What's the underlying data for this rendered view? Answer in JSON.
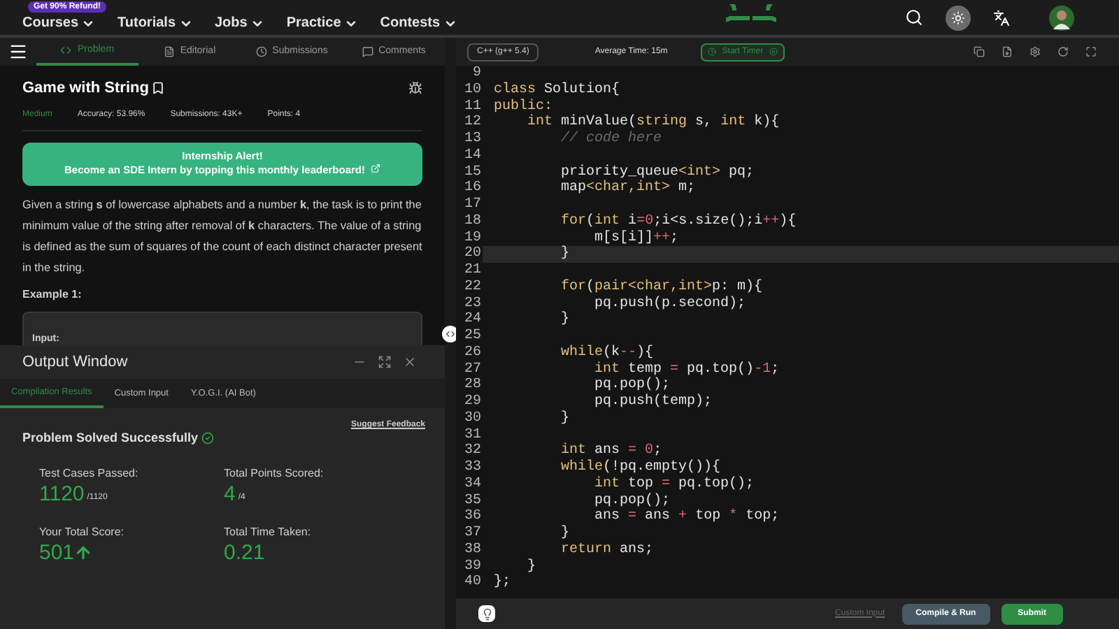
{
  "promo_badge": "Get 90% Refund!",
  "nav": [
    {
      "label": "Courses"
    },
    {
      "label": "Tutorials"
    },
    {
      "label": "Jobs"
    },
    {
      "label": "Practice"
    },
    {
      "label": "Contests"
    }
  ],
  "problem_tabs": [
    {
      "label": "Problem",
      "selected": true
    },
    {
      "label": "Editorial",
      "selected": false
    },
    {
      "label": "Submissions",
      "selected": false
    },
    {
      "label": "Comments",
      "selected": false
    }
  ],
  "problem": {
    "title": "Game with String",
    "difficulty": "Medium",
    "accuracy": "Accuracy: 53.96%",
    "submissions": "Submissions: 43K+",
    "points": "Points: 4",
    "alert": {
      "title": "Internship Alert!",
      "text": "Become an SDE Intern by topping this monthly leaderboard!"
    },
    "description": "Given a string **s** of lowercase alphabets and a number **k**, the task is to print the minimum value of the string after removal of **k** characters. The value of a string is defined as the sum of squares of the count of each distinct character present in the string.",
    "example_heading": "Example 1:",
    "example_input": "Input:"
  },
  "output_window": {
    "title": "Output Window",
    "tabs": [
      {
        "label": "Compilation Results",
        "selected": true
      },
      {
        "label": "Custom Input",
        "selected": false
      },
      {
        "label": "Y.O.G.I. (AI Bot)",
        "selected": false
      }
    ],
    "feedback_link": "Suggest Feedback",
    "status": "Problem Solved Successfully",
    "stats": [
      {
        "label": "Test Cases Passed:",
        "value": "1120",
        "total": "/1120",
        "rising": false
      },
      {
        "label": "Total Points Scored:",
        "value": "4",
        "total": "/4",
        "rising": false
      },
      {
        "label": "Your Total Score:",
        "value": "501",
        "rising": true
      },
      {
        "label": "Total Time Taken:",
        "value": "0.21",
        "rising": false
      }
    ]
  },
  "editor": {
    "language": "C++ (g++ 5.4)",
    "average_time": "Average Time: 15m",
    "timer_button": "Start Timer",
    "lines": [
      {
        "number": "9",
        "current": false
      },
      {
        "number": "10",
        "current": false,
        "tokens": [
          {
            "kind": "kw",
            "text": "class"
          },
          {
            "kind": "id",
            "text": " Solution{"
          }
        ]
      },
      {
        "number": "11",
        "current": false,
        "tokens": [
          {
            "kind": "kw",
            "text": "public:"
          }
        ]
      },
      {
        "number": "12",
        "current": false,
        "tokens": [
          {
            "kind": "kw",
            "text": "    int"
          },
          {
            "kind": "id",
            "text": " minValue("
          },
          {
            "kind": "kw",
            "text": "string"
          },
          {
            "kind": "id",
            "text": " s, "
          },
          {
            "kind": "kw",
            "text": "int"
          },
          {
            "kind": "id",
            "text": " k){"
          }
        ]
      },
      {
        "number": "13",
        "current": false,
        "tokens": [
          {
            "kind": "cm",
            "text": "        // code here"
          }
        ]
      },
      {
        "number": "14",
        "current": false
      },
      {
        "number": "15",
        "current": false,
        "tokens": [
          {
            "kind": "id",
            "text": "        priority_queue"
          },
          {
            "kind": "kw",
            "text": "<int>"
          },
          {
            "kind": "id",
            "text": " pq;"
          }
        ]
      },
      {
        "number": "16",
        "current": false,
        "tokens": [
          {
            "kind": "id",
            "text": "        map"
          },
          {
            "kind": "kw",
            "text": "<char,int>"
          },
          {
            "kind": "id",
            "text": " m;"
          }
        ]
      },
      {
        "number": "17",
        "current": false
      },
      {
        "number": "18",
        "current": false,
        "tokens": [
          {
            "kind": "kw",
            "text": "        for"
          },
          {
            "kind": "id",
            "text": "("
          },
          {
            "kind": "kw",
            "text": "int"
          },
          {
            "kind": "id",
            "text": " i"
          },
          {
            "kind": "op",
            "text": "="
          },
          {
            "kind": "num",
            "text": "0"
          },
          {
            "kind": "id",
            "text": ";i<s.size();i"
          },
          {
            "kind": "op",
            "text": "++"
          },
          {
            "kind": "id",
            "text": "){"
          }
        ]
      },
      {
        "number": "19",
        "current": false,
        "tokens": [
          {
            "kind": "id",
            "text": "            m[s[i]]"
          },
          {
            "kind": "op",
            "text": "++"
          },
          {
            "kind": "id",
            "text": ";"
          }
        ]
      },
      {
        "number": "20",
        "current": true,
        "tokens": [
          {
            "kind": "id",
            "text": "        }"
          }
        ]
      },
      {
        "number": "21",
        "current": false
      },
      {
        "number": "22",
        "current": false,
        "tokens": [
          {
            "kind": "kw",
            "text": "        for"
          },
          {
            "kind": "id",
            "text": "("
          },
          {
            "kind": "kw",
            "text": "pair<char,int>"
          },
          {
            "kind": "id",
            "text": "p: m){"
          }
        ]
      },
      {
        "number": "23",
        "current": false,
        "tokens": [
          {
            "kind": "id",
            "text": "            pq.push(p.second);"
          }
        ]
      },
      {
        "number": "24",
        "current": false,
        "tokens": [
          {
            "kind": "id",
            "text": "        }"
          }
        ]
      },
      {
        "number": "25",
        "current": false
      },
      {
        "number": "26",
        "current": false,
        "tokens": [
          {
            "kind": "kw",
            "text": "        while"
          },
          {
            "kind": "id",
            "text": "(k"
          },
          {
            "kind": "op",
            "text": "--"
          },
          {
            "kind": "id",
            "text": "){"
          }
        ]
      },
      {
        "number": "27",
        "current": false,
        "tokens": [
          {
            "kind": "kw",
            "text": "            int"
          },
          {
            "kind": "id",
            "text": " temp "
          },
          {
            "kind": "op",
            "text": "="
          },
          {
            "kind": "id",
            "text": " pq.top()"
          },
          {
            "kind": "num",
            "text": "-1"
          },
          {
            "kind": "id",
            "text": ";"
          }
        ]
      },
      {
        "number": "28",
        "current": false,
        "tokens": [
          {
            "kind": "id",
            "text": "            pq.pop();"
          }
        ]
      },
      {
        "number": "29",
        "current": false,
        "tokens": [
          {
            "kind": "id",
            "text": "            pq.push(temp);"
          }
        ]
      },
      {
        "number": "30",
        "current": false,
        "tokens": [
          {
            "kind": "id",
            "text": "        }"
          }
        ]
      },
      {
        "number": "31",
        "current": false
      },
      {
        "number": "32",
        "current": false,
        "tokens": [
          {
            "kind": "kw",
            "text": "        int"
          },
          {
            "kind": "id",
            "text": " ans "
          },
          {
            "kind": "op",
            "text": "="
          },
          {
            "kind": "num",
            "text": " 0"
          },
          {
            "kind": "id",
            "text": ";"
          }
        ]
      },
      {
        "number": "33",
        "current": false,
        "tokens": [
          {
            "kind": "kw",
            "text": "        while"
          },
          {
            "kind": "id",
            "text": "(!pq.empty()){"
          }
        ]
      },
      {
        "number": "34",
        "current": false,
        "tokens": [
          {
            "kind": "kw",
            "text": "            int"
          },
          {
            "kind": "id",
            "text": " top "
          },
          {
            "kind": "op",
            "text": "="
          },
          {
            "kind": "id",
            "text": " pq.top();"
          }
        ]
      },
      {
        "number": "35",
        "current": false,
        "tokens": [
          {
            "kind": "id",
            "text": "            pq.pop();"
          }
        ]
      },
      {
        "number": "36",
        "current": false,
        "tokens": [
          {
            "kind": "id",
            "text": "            ans "
          },
          {
            "kind": "op",
            "text": "="
          },
          {
            "kind": "id",
            "text": " ans "
          },
          {
            "kind": "op",
            "text": "+"
          },
          {
            "kind": "id",
            "text": " top "
          },
          {
            "kind": "op",
            "text": "*"
          },
          {
            "kind": "id",
            "text": " top;"
          }
        ]
      },
      {
        "number": "37",
        "current": false,
        "tokens": [
          {
            "kind": "id",
            "text": "        }"
          }
        ]
      },
      {
        "number": "38",
        "current": false,
        "tokens": [
          {
            "kind": "kw",
            "text": "        return"
          },
          {
            "kind": "id",
            "text": " ans;"
          }
        ]
      },
      {
        "number": "39",
        "current": false,
        "tokens": [
          {
            "kind": "id",
            "text": "    }"
          }
        ]
      },
      {
        "number": "40",
        "current": false,
        "tokens": [
          {
            "kind": "id",
            "text": "};"
          }
        ]
      }
    ]
  },
  "footer": {
    "custom_input": "Custom Input",
    "compile_button": "Compile & Run",
    "submit_button": "Submit"
  }
}
